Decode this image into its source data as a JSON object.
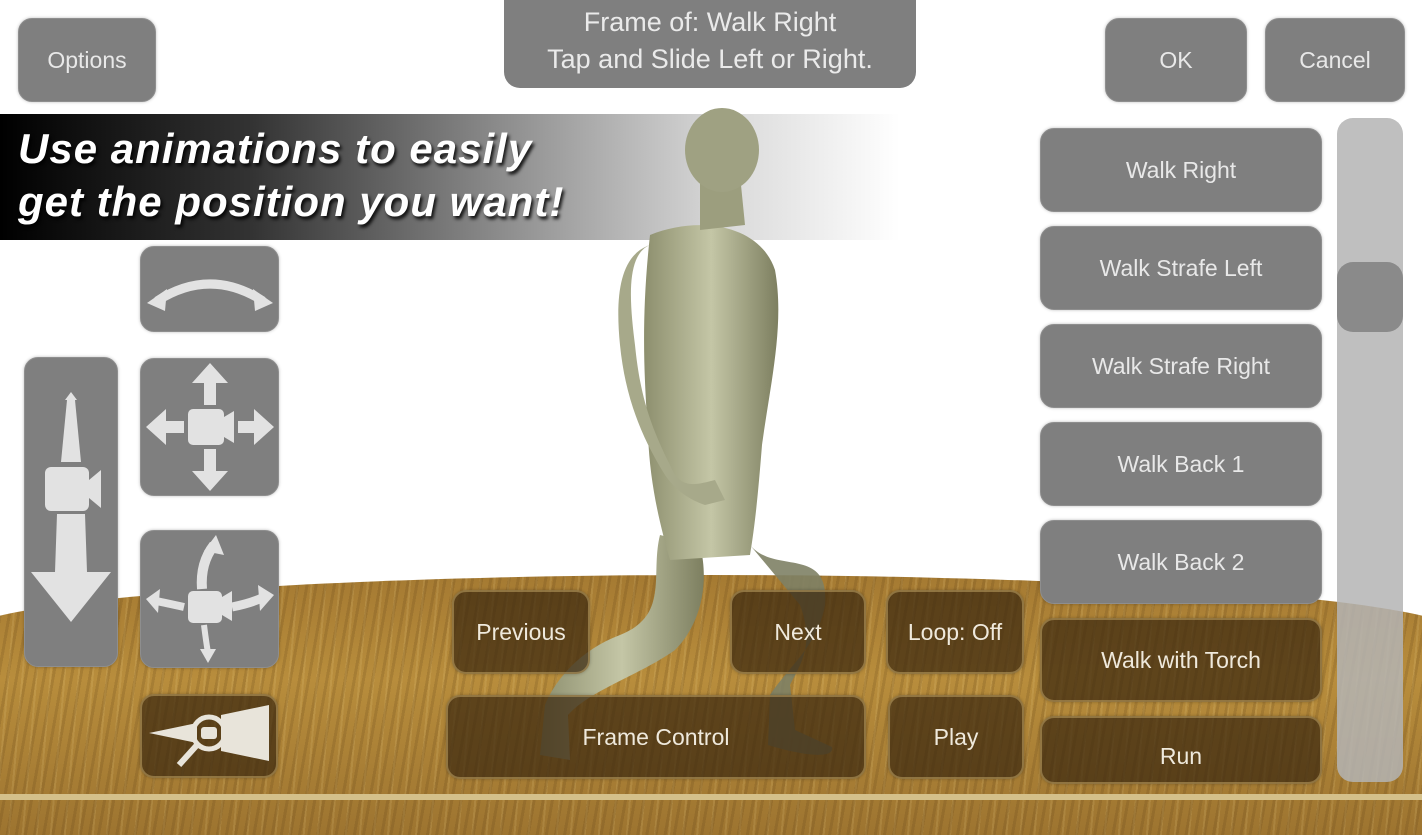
{
  "header": {
    "options_label": "Options",
    "status_line1": "Frame of: Walk Right",
    "status_line2": "Tap and Slide Left or Right.",
    "ok_label": "OK",
    "cancel_label": "Cancel"
  },
  "banner": {
    "line1": "Use animations to easily",
    "line2": "get the position you want!"
  },
  "camera_controls": {
    "icons": [
      "orbit-arc-icon",
      "pan-camera-icon",
      "dolly-camera-icon",
      "rotate-camera-icon",
      "zoom-camera-icon"
    ]
  },
  "animation_list": {
    "items": [
      {
        "label": "Walk Right"
      },
      {
        "label": "Walk Strafe Left"
      },
      {
        "label": "Walk Strafe Right"
      },
      {
        "label": "Walk Back 1"
      },
      {
        "label": "Walk Back 2"
      },
      {
        "label": "Walk with Torch"
      },
      {
        "label": "Run"
      }
    ],
    "selected": "Walk Right",
    "scroll_position": 0.25
  },
  "playback": {
    "previous_label": "Previous",
    "next_label": "Next",
    "loop_label": "Loop: Off",
    "frame_control_label": "Frame Control",
    "play_label": "Play"
  },
  "colors": {
    "button_gray": "#7f7f7f",
    "floor_wood": "#b08538",
    "button_text": "#e8e8e8"
  }
}
